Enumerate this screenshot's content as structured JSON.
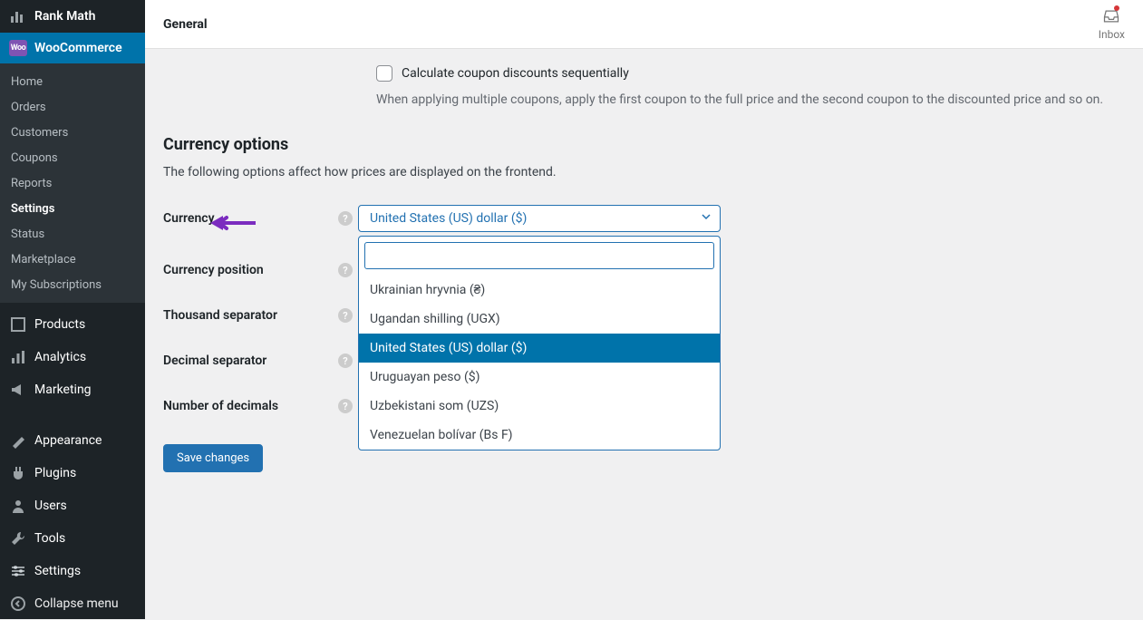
{
  "sidebar": {
    "rankmath": "Rank Math",
    "woocommerce": "WooCommerce",
    "subitems": [
      "Home",
      "Orders",
      "Customers",
      "Coupons",
      "Reports",
      "Settings",
      "Status",
      "Marketplace",
      "My Subscriptions"
    ],
    "current_sub_index": 5,
    "groups": [
      {
        "icon": "products",
        "label": "Products"
      },
      {
        "icon": "analytics",
        "label": "Analytics"
      },
      {
        "icon": "marketing",
        "label": "Marketing"
      }
    ],
    "groups2": [
      {
        "icon": "appearance",
        "label": "Appearance"
      },
      {
        "icon": "plugins",
        "label": "Plugins"
      },
      {
        "icon": "users",
        "label": "Users"
      },
      {
        "icon": "tools",
        "label": "Tools"
      },
      {
        "icon": "settings",
        "label": "Settings"
      }
    ],
    "collapse": "Collapse menu"
  },
  "header": {
    "title": "General",
    "inbox": "Inbox"
  },
  "coupon": {
    "checkbox_label": "Calculate coupon discounts sequentially",
    "helper": "When applying multiple coupons, apply the first coupon to the full price and the second coupon to the discounted price and so on."
  },
  "currency": {
    "section_title": "Currency options",
    "section_desc": "The following options affect how prices are displayed on the frontend.",
    "labels": {
      "currency": "Currency",
      "position": "Currency position",
      "thousand": "Thousand separator",
      "decimal": "Decimal separator",
      "decimals": "Number of decimals"
    },
    "selected": "United States (US) dollar ($)",
    "options": [
      "Ukrainian hryvnia (₴)",
      "Ugandan shilling (UGX)",
      "United States (US) dollar ($)",
      "Uruguayan peso ($)",
      "Uzbekistani som (UZS)",
      "Venezuelan bolívar (Bs F)"
    ],
    "selected_index": 2
  },
  "save_label": "Save changes"
}
